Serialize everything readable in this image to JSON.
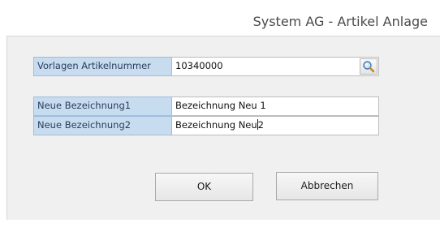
{
  "window": {
    "title": "System AG - Artikel Anlage"
  },
  "form": {
    "template_article": {
      "label": "Vorlagen Artikelnummer",
      "value": "10340000"
    },
    "name1": {
      "label": "Neue Bezeichnung1",
      "value": "Bezeichnung Neu 1"
    },
    "name2": {
      "label": "Neue Bezeichnung2",
      "value_before_cursor": "Bezeichnung Neu",
      "value_after_cursor": "2"
    }
  },
  "buttons": {
    "ok_label": "OK",
    "cancel_label": "Abbrechen"
  },
  "icons": {
    "search": "search-icon"
  },
  "colors": {
    "label_background": "#c8dcf0",
    "label_border": "#9fbddd",
    "panel_background": "#f0f0f0"
  }
}
